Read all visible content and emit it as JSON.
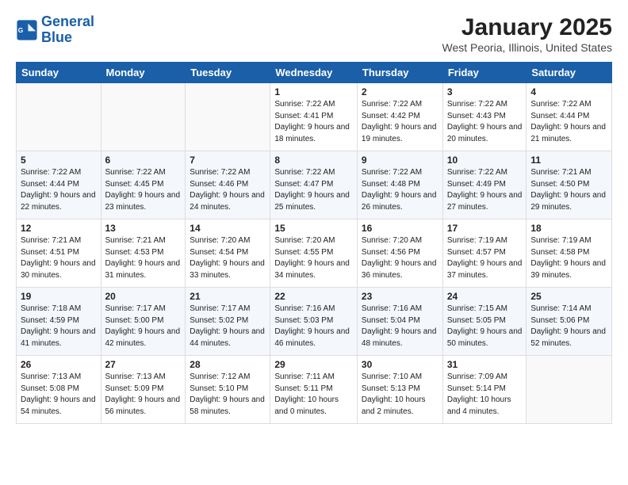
{
  "header": {
    "logo_line1": "General",
    "logo_line2": "Blue",
    "title": "January 2025",
    "subtitle": "West Peoria, Illinois, United States"
  },
  "days_of_week": [
    "Sunday",
    "Monday",
    "Tuesday",
    "Wednesday",
    "Thursday",
    "Friday",
    "Saturday"
  ],
  "weeks": [
    [
      {
        "day": "",
        "info": ""
      },
      {
        "day": "",
        "info": ""
      },
      {
        "day": "",
        "info": ""
      },
      {
        "day": "1",
        "info": "Sunrise: 7:22 AM\nSunset: 4:41 PM\nDaylight: 9 hours and 18 minutes."
      },
      {
        "day": "2",
        "info": "Sunrise: 7:22 AM\nSunset: 4:42 PM\nDaylight: 9 hours and 19 minutes."
      },
      {
        "day": "3",
        "info": "Sunrise: 7:22 AM\nSunset: 4:43 PM\nDaylight: 9 hours and 20 minutes."
      },
      {
        "day": "4",
        "info": "Sunrise: 7:22 AM\nSunset: 4:44 PM\nDaylight: 9 hours and 21 minutes."
      }
    ],
    [
      {
        "day": "5",
        "info": "Sunrise: 7:22 AM\nSunset: 4:44 PM\nDaylight: 9 hours and 22 minutes."
      },
      {
        "day": "6",
        "info": "Sunrise: 7:22 AM\nSunset: 4:45 PM\nDaylight: 9 hours and 23 minutes."
      },
      {
        "day": "7",
        "info": "Sunrise: 7:22 AM\nSunset: 4:46 PM\nDaylight: 9 hours and 24 minutes."
      },
      {
        "day": "8",
        "info": "Sunrise: 7:22 AM\nSunset: 4:47 PM\nDaylight: 9 hours and 25 minutes."
      },
      {
        "day": "9",
        "info": "Sunrise: 7:22 AM\nSunset: 4:48 PM\nDaylight: 9 hours and 26 minutes."
      },
      {
        "day": "10",
        "info": "Sunrise: 7:22 AM\nSunset: 4:49 PM\nDaylight: 9 hours and 27 minutes."
      },
      {
        "day": "11",
        "info": "Sunrise: 7:21 AM\nSunset: 4:50 PM\nDaylight: 9 hours and 29 minutes."
      }
    ],
    [
      {
        "day": "12",
        "info": "Sunrise: 7:21 AM\nSunset: 4:51 PM\nDaylight: 9 hours and 30 minutes."
      },
      {
        "day": "13",
        "info": "Sunrise: 7:21 AM\nSunset: 4:53 PM\nDaylight: 9 hours and 31 minutes."
      },
      {
        "day": "14",
        "info": "Sunrise: 7:20 AM\nSunset: 4:54 PM\nDaylight: 9 hours and 33 minutes."
      },
      {
        "day": "15",
        "info": "Sunrise: 7:20 AM\nSunset: 4:55 PM\nDaylight: 9 hours and 34 minutes."
      },
      {
        "day": "16",
        "info": "Sunrise: 7:20 AM\nSunset: 4:56 PM\nDaylight: 9 hours and 36 minutes."
      },
      {
        "day": "17",
        "info": "Sunrise: 7:19 AM\nSunset: 4:57 PM\nDaylight: 9 hours and 37 minutes."
      },
      {
        "day": "18",
        "info": "Sunrise: 7:19 AM\nSunset: 4:58 PM\nDaylight: 9 hours and 39 minutes."
      }
    ],
    [
      {
        "day": "19",
        "info": "Sunrise: 7:18 AM\nSunset: 4:59 PM\nDaylight: 9 hours and 41 minutes."
      },
      {
        "day": "20",
        "info": "Sunrise: 7:17 AM\nSunset: 5:00 PM\nDaylight: 9 hours and 42 minutes."
      },
      {
        "day": "21",
        "info": "Sunrise: 7:17 AM\nSunset: 5:02 PM\nDaylight: 9 hours and 44 minutes."
      },
      {
        "day": "22",
        "info": "Sunrise: 7:16 AM\nSunset: 5:03 PM\nDaylight: 9 hours and 46 minutes."
      },
      {
        "day": "23",
        "info": "Sunrise: 7:16 AM\nSunset: 5:04 PM\nDaylight: 9 hours and 48 minutes."
      },
      {
        "day": "24",
        "info": "Sunrise: 7:15 AM\nSunset: 5:05 PM\nDaylight: 9 hours and 50 minutes."
      },
      {
        "day": "25",
        "info": "Sunrise: 7:14 AM\nSunset: 5:06 PM\nDaylight: 9 hours and 52 minutes."
      }
    ],
    [
      {
        "day": "26",
        "info": "Sunrise: 7:13 AM\nSunset: 5:08 PM\nDaylight: 9 hours and 54 minutes."
      },
      {
        "day": "27",
        "info": "Sunrise: 7:13 AM\nSunset: 5:09 PM\nDaylight: 9 hours and 56 minutes."
      },
      {
        "day": "28",
        "info": "Sunrise: 7:12 AM\nSunset: 5:10 PM\nDaylight: 9 hours and 58 minutes."
      },
      {
        "day": "29",
        "info": "Sunrise: 7:11 AM\nSunset: 5:11 PM\nDaylight: 10 hours and 0 minutes."
      },
      {
        "day": "30",
        "info": "Sunrise: 7:10 AM\nSunset: 5:13 PM\nDaylight: 10 hours and 2 minutes."
      },
      {
        "day": "31",
        "info": "Sunrise: 7:09 AM\nSunset: 5:14 PM\nDaylight: 10 hours and 4 minutes."
      },
      {
        "day": "",
        "info": ""
      }
    ]
  ]
}
